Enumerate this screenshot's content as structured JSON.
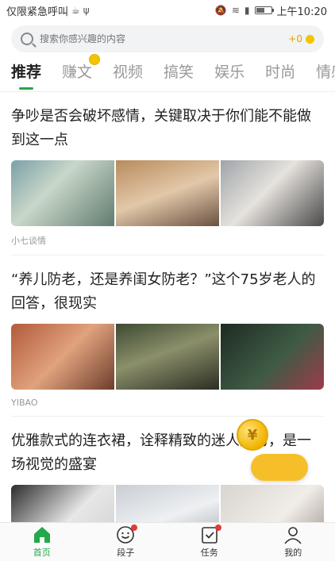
{
  "status_bar": {
    "left_text": "仅限紧急呼叫",
    "time": "上午10:20"
  },
  "search": {
    "placeholder": "搜索你感兴趣的内容",
    "coin_text": "+0"
  },
  "tabs": [
    {
      "label": "推荐",
      "active": true
    },
    {
      "label": "赚文",
      "badge": "coin"
    },
    {
      "label": "视频"
    },
    {
      "label": "搞笑"
    },
    {
      "label": "娱乐"
    },
    {
      "label": "时尚"
    },
    {
      "label": "情感"
    }
  ],
  "articles": [
    {
      "title": "争吵是否会破坏感情，关键取决于你们能不能做到这一点",
      "source": "小七谈情"
    },
    {
      "title": "“养儿防老，还是养闺女防老？”这个75岁老人的回答，很现实",
      "source": "YIBAO"
    },
    {
      "title": "优雅款式的连衣裙，诠释精致的迷人魅力，是一场视觉的盛宴",
      "source": ""
    }
  ],
  "floating_reward": {
    "symbol": "¥"
  },
  "bottom_nav": [
    {
      "label": "首页",
      "icon": "home-icon",
      "active": true
    },
    {
      "label": "段子",
      "icon": "smile-icon",
      "badge": true
    },
    {
      "label": "任务",
      "icon": "task-icon",
      "badge": true
    },
    {
      "label": "我的",
      "icon": "user-icon"
    }
  ],
  "colors": {
    "accent": "#23a94a",
    "coin": "#f4c400",
    "badge": "#e53935"
  }
}
